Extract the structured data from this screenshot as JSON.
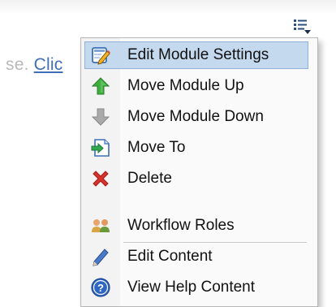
{
  "page": {
    "text_before_link": "se. ",
    "link_text": "Clic"
  },
  "menu_trigger": {
    "icon": "menu-list-icon"
  },
  "menu": {
    "items": [
      {
        "label": "Edit Module Settings",
        "icon": "edit-settings-icon",
        "selected": true
      },
      {
        "label": "Move Module Up",
        "icon": "arrow-up-icon"
      },
      {
        "label": "Move Module Down",
        "icon": "arrow-down-icon"
      },
      {
        "label": "Move To",
        "icon": "move-to-icon"
      },
      {
        "label": "Delete",
        "icon": "delete-icon"
      },
      {
        "label": "Workflow Roles",
        "icon": "workflow-roles-icon"
      },
      {
        "label": "Edit Content",
        "icon": "pencil-icon"
      },
      {
        "label": "View Help Content",
        "icon": "help-icon"
      }
    ]
  },
  "colors": {
    "selection_bg": "#c4d9ee",
    "selection_border": "#8fb2da",
    "link": "#3f6fb8"
  }
}
